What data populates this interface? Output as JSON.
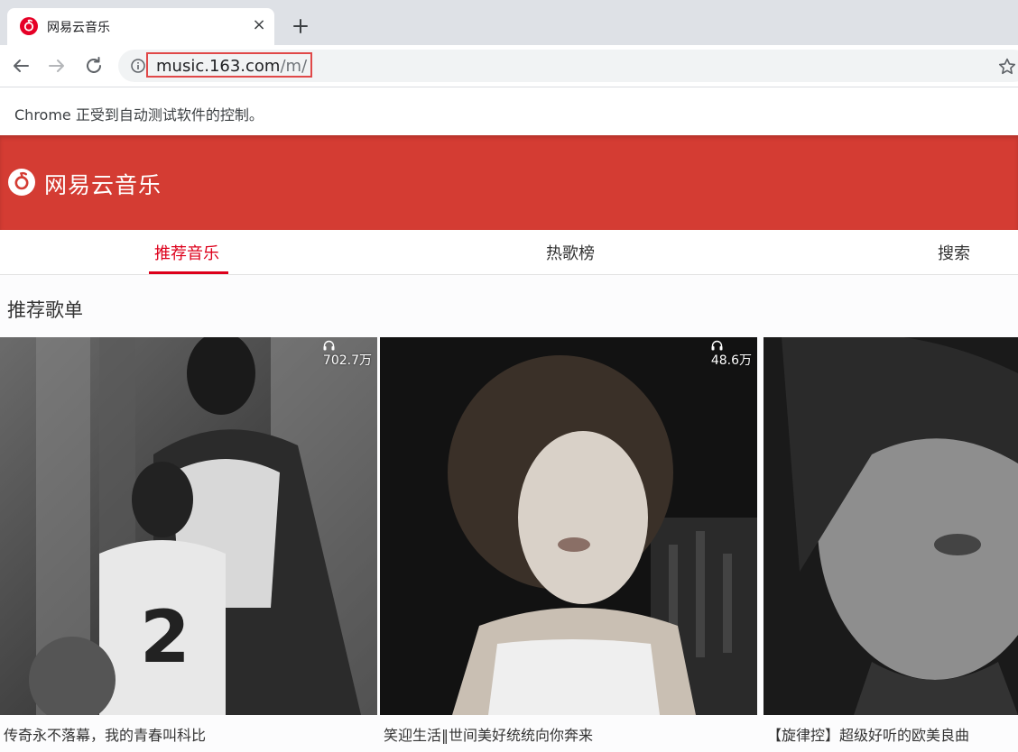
{
  "browser": {
    "tab_title": "网易云音乐",
    "tab_close": "×",
    "url_host": "music.163.com",
    "url_path": "/m/",
    "infobar_text": "Chrome 正受到自动测试软件的控制。"
  },
  "site": {
    "logo_text": "网易云音乐",
    "brand_color": "#d43c33",
    "accent_color": "#dd001b",
    "tabs": [
      {
        "label": "推荐音乐",
        "active": true
      },
      {
        "label": "热歌榜",
        "active": false
      },
      {
        "label": "搜索",
        "active": false
      }
    ],
    "section_title": "推荐歌单",
    "playlists": [
      {
        "title": "传奇永不落幕，我的青春叫科比",
        "play_count": "702.7万"
      },
      {
        "title": "笑迎生活‖世间美好统统向你奔来",
        "play_count": "48.6万"
      },
      {
        "title": "【旋律控】超级好听的欧美良曲",
        "play_count": ""
      }
    ]
  }
}
